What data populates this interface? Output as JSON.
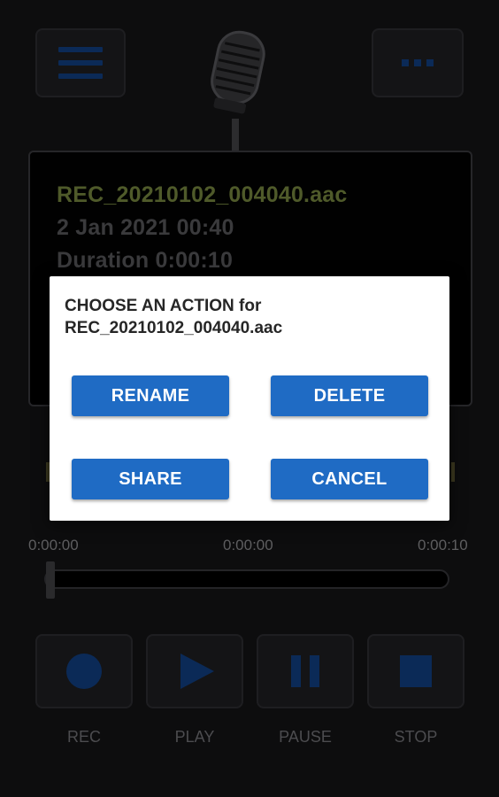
{
  "toolbar": {
    "menu_icon": "hamburger-menu-icon",
    "more_icon": "more-options-icon",
    "logo_icon": "microphone-icon"
  },
  "recording": {
    "filename": "REC_20210102_004040.aac",
    "date": "2 Jan 2021 00:40",
    "duration": "Duration 0:00:10"
  },
  "timeline": {
    "start": "0:00:00",
    "current": "0:00:00",
    "end": "0:00:10",
    "progress_fraction": 0.0
  },
  "controls": {
    "rec": "REC",
    "play": "PLAY",
    "pause": "PAUSE",
    "stop": "STOP"
  },
  "dialog": {
    "title_line1": "CHOOSE AN ACTION for",
    "title_line2": "REC_20210102_004040.aac",
    "rename": "RENAME",
    "delete": "DELETE",
    "share": "SHARE",
    "cancel": "CANCEL"
  },
  "colors": {
    "accent_blue": "#1f6bc4",
    "icon_blue": "#0b2a57",
    "filename_green": "#4f5a2a",
    "background": "#0d0d0e"
  }
}
